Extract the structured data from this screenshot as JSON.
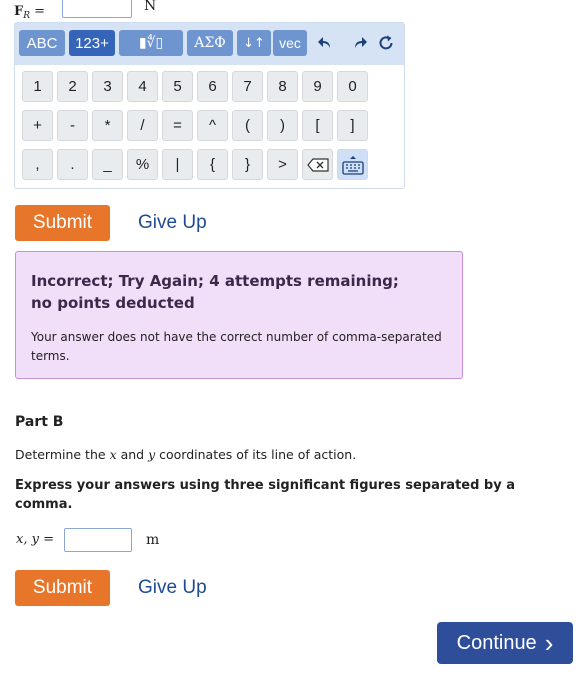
{
  "part_a": {
    "label_main": "F",
    "label_sub": "R",
    "label_eq": " =",
    "input_value": "",
    "unit": "N"
  },
  "keyboard": {
    "toolbar": {
      "abc": "ABC",
      "num": "123+",
      "templates": "▮∜▯",
      "greek": "ΑΣΦ",
      "arrows": "↓↑",
      "vec": "vec",
      "undo_icon": "undo-arrow-icon",
      "redo_icon": "redo-arrow-icon",
      "reset_icon": "refresh-icon"
    },
    "row1": [
      "1",
      "2",
      "3",
      "4",
      "5",
      "6",
      "7",
      "8",
      "9",
      "0"
    ],
    "row2": [
      "+",
      "-",
      "*",
      "/",
      "=",
      "^",
      "(",
      ")",
      "[",
      "]"
    ],
    "row3": [
      ",",
      ".",
      "_",
      "%",
      "|",
      "{",
      "}",
      ">"
    ],
    "backspace_icon": "backspace-icon",
    "keyboard_icon": "keyboard-toggle-icon"
  },
  "actions_a": {
    "submit": "Submit",
    "give_up": "Give Up"
  },
  "feedback": {
    "title_line1": "Incorrect; Try Again; 4 attempts remaining;",
    "title_line2": "no points deducted",
    "message": "Your answer does not have the correct number of comma-separated terms.",
    "colors": {
      "background": "#f1def9",
      "border": "#c58fdc"
    }
  },
  "part_b": {
    "title": "Part B",
    "instruction_pre": "Determine the ",
    "instruction_x": "x",
    "instruction_mid": " and ",
    "instruction_y": "y",
    "instruction_post": " coordinates of its line of action.",
    "format": "Express your answers using three significant figures separated by a comma.",
    "label": "x, y =",
    "input_value": "",
    "unit": "m"
  },
  "actions_b": {
    "submit": "Submit",
    "give_up": "Give Up"
  },
  "continue": {
    "label": "Continue",
    "chevron": "›"
  },
  "colors": {
    "submit": "#e8762a",
    "link": "#1f4b94",
    "continue": "#2e4e9a",
    "toolbar": "#d6e3f4"
  }
}
